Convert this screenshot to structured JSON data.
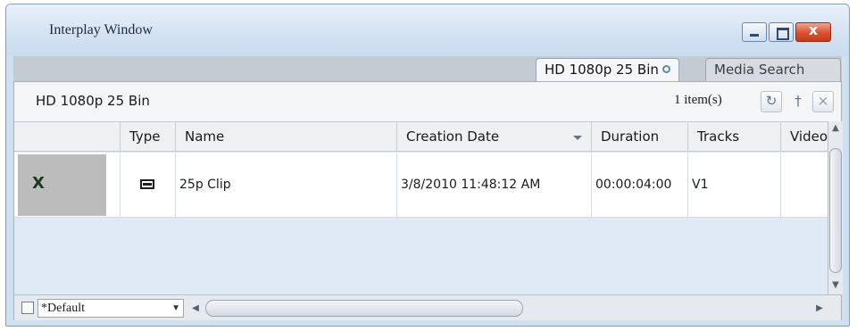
{
  "window": {
    "title": "Interplay Window",
    "controls": {
      "minimize_icon": "minimize-icon",
      "maximize_icon": "maximize-icon",
      "close_label": "x"
    }
  },
  "tabs": [
    {
      "label": "HD 1080p 25 Bin",
      "active": true
    },
    {
      "label": "Media Search",
      "active": false
    }
  ],
  "bin": {
    "title": "HD 1080p 25 Bin",
    "item_count": "1 item(s)",
    "buttons": {
      "refresh_icon": "refresh-icon",
      "pin_icon": "pin-icon",
      "close_label": "×"
    }
  },
  "table": {
    "columns": [
      "",
      "Type",
      "Name",
      "Creation Date",
      "Duration",
      "Tracks",
      "Video"
    ],
    "sort_column": "Creation Date",
    "rows": [
      {
        "type_icon": "clip-icon",
        "name": "25p Clip",
        "creation_date": "3/8/2010 11:48:12 AM",
        "duration": "00:00:04:00",
        "tracks": "V1",
        "video": ""
      }
    ]
  },
  "statusbar": {
    "view_select": "*Default"
  },
  "colors": {
    "window_frame": "#cfe0f0",
    "grid_background": "#dfeaf5",
    "close_button": "#d9502f"
  }
}
